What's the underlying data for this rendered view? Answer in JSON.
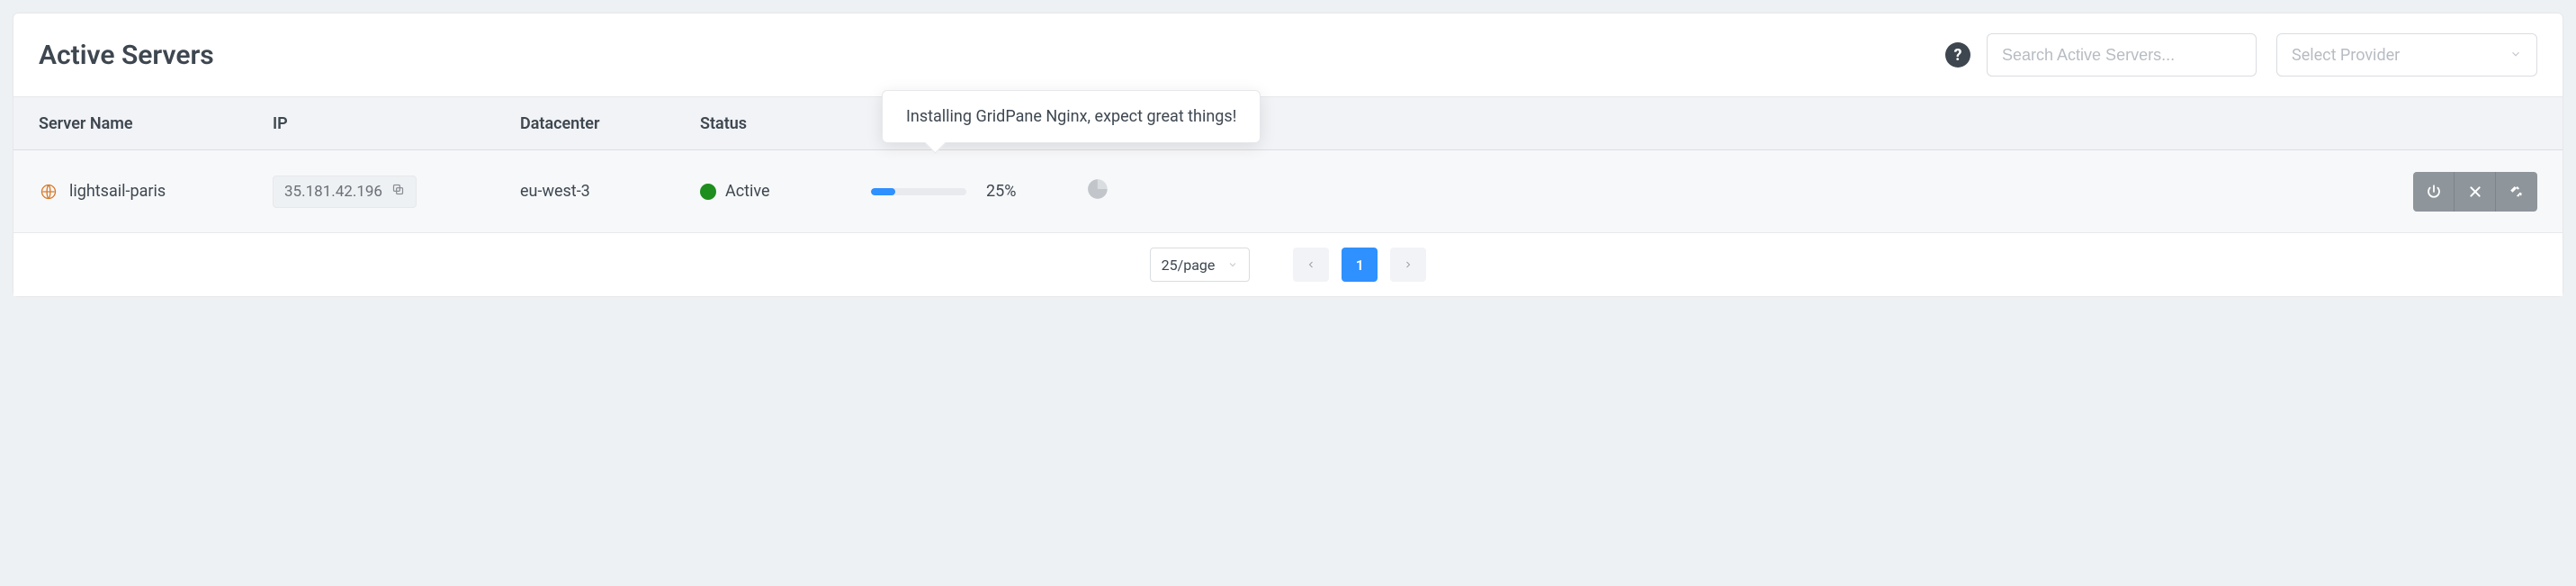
{
  "header": {
    "title": "Active Servers",
    "search_placeholder": "Search Active Servers...",
    "provider_placeholder": "Select Provider"
  },
  "columns": {
    "server": "Server Name",
    "ip": "IP",
    "datacenter": "Datacenter",
    "status": "Status"
  },
  "tooltip": "Installing GridPane Nginx, expect great things!",
  "row": {
    "server_name": "lightsail-paris",
    "ip": "35.181.42.196",
    "datacenter": "eu-west-3",
    "status_label": "Active",
    "status_color": "#1e8e1e",
    "progress_pct": 25,
    "progress_label": "25%"
  },
  "footer": {
    "page_size_label": "25/page",
    "current_page": "1"
  },
  "colors": {
    "accent": "#2f90ff",
    "action_grey": "#8e959b"
  }
}
